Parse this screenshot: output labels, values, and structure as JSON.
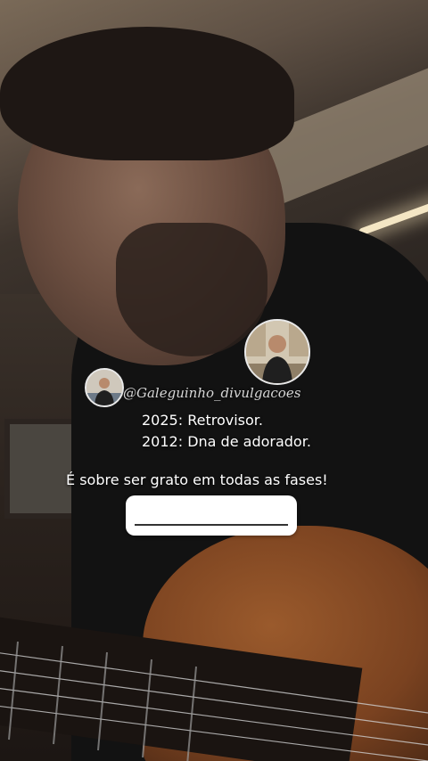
{
  "story": {
    "overlay": {
      "handle": "@Galeguinho_divulgacoes",
      "line1": "2025: Retrovisor.",
      "line2": "2012: Dna de adorador.",
      "line3": "É sobre ser grato em todas as fases!"
    },
    "avatars": {
      "large_icon": "profile-photo",
      "small_icon": "profile-photo"
    },
    "reply_box": {
      "placeholder": ""
    }
  },
  "colors": {
    "text": "#ffffff",
    "handle_text": "#d6d6d6",
    "reply_box_bg": "#ffffff"
  }
}
